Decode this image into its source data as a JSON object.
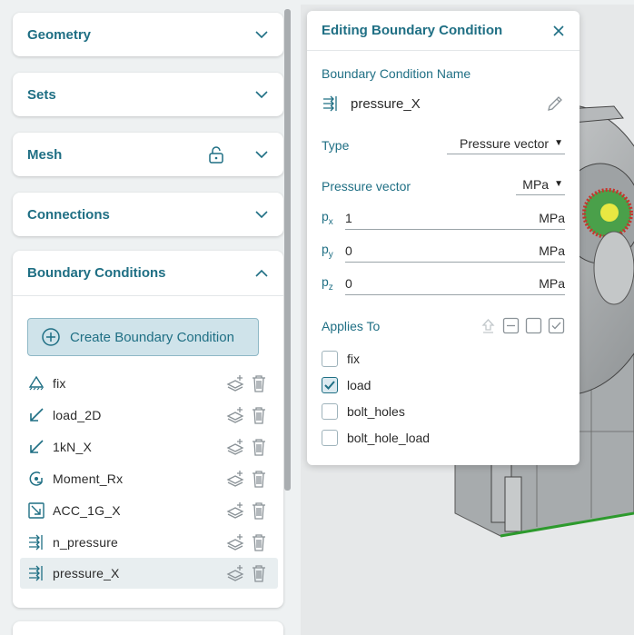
{
  "sidebar": {
    "sections": [
      {
        "label": "Geometry"
      },
      {
        "label": "Sets"
      },
      {
        "label": "Mesh"
      },
      {
        "label": "Connections"
      }
    ],
    "boundary_conditions": {
      "header": "Boundary Conditions",
      "create_label": "Create Boundary Condition",
      "items": [
        {
          "name": "fix",
          "icon": "fixed-support-icon"
        },
        {
          "name": "load_2D",
          "icon": "force-arrow-icon"
        },
        {
          "name": "1kN_X",
          "icon": "force-arrow-icon"
        },
        {
          "name": "Moment_Rx",
          "icon": "moment-icon"
        },
        {
          "name": "ACC_1G_X",
          "icon": "acceleration-icon"
        },
        {
          "name": "n_pressure",
          "icon": "pressure-icon"
        },
        {
          "name": "pressure_X",
          "icon": "pressure-icon",
          "selected": true
        }
      ]
    }
  },
  "editor": {
    "title": "Editing Boundary Condition",
    "name_label": "Boundary Condition Name",
    "name_value": "pressure_X",
    "type_label": "Type",
    "type_value": "Pressure vector",
    "vector_label": "Pressure vector",
    "vector_unit": "MPa",
    "components": [
      {
        "symbol": "p",
        "sub": "x",
        "value": "1",
        "unit": "MPa"
      },
      {
        "symbol": "p",
        "sub": "y",
        "value": "0",
        "unit": "MPa"
      },
      {
        "symbol": "p",
        "sub": "z",
        "value": "0",
        "unit": "MPa"
      }
    ],
    "applies_label": "Applies To",
    "targets": [
      {
        "label": "fix",
        "checked": false
      },
      {
        "label": "load",
        "checked": true
      },
      {
        "label": "bolt_holes",
        "checked": false
      },
      {
        "label": "bolt_hole_load",
        "checked": false
      }
    ]
  },
  "colors": {
    "accent": "#1f6f84",
    "button_bg": "#cfe3ea",
    "selected_row": "#e8eef0"
  }
}
